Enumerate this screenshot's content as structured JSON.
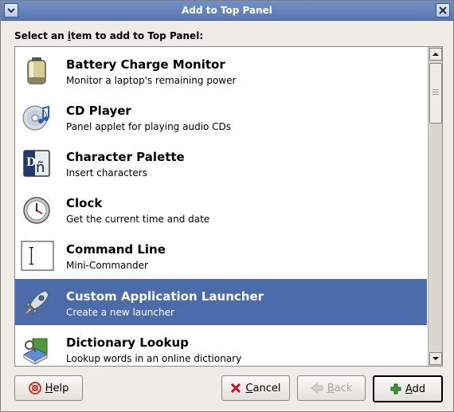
{
  "window": {
    "title": "Add to Top Panel"
  },
  "prompt": {
    "pre": "Select an ",
    "mnemonic": "i",
    "post": "tem to add to Top Panel:"
  },
  "items": [
    {
      "title": "Battery Charge Monitor",
      "description": "Monitor a laptop's remaining power",
      "icon": "battery-icon"
    },
    {
      "title": "CD Player",
      "description": "Panel applet for playing audio CDs",
      "icon": "cd-player-icon"
    },
    {
      "title": "Character Palette",
      "description": "Insert characters",
      "icon": "character-palette-icon"
    },
    {
      "title": "Clock",
      "description": "Get the current time and date",
      "icon": "clock-icon"
    },
    {
      "title": "Command Line",
      "description": "Mini-Commander",
      "icon": "command-line-icon"
    },
    {
      "title": "Custom Application Launcher",
      "description": "Create a new launcher",
      "icon": "rocket-icon",
      "selected": true
    },
    {
      "title": "Dictionary Lookup",
      "description": "Lookup words in an online dictionary",
      "icon": "dictionary-icon"
    }
  ],
  "palette_glyph": "ñ",
  "buttons": {
    "help": {
      "mnemonic": "H",
      "rest": "elp"
    },
    "cancel": {
      "mnemonic": "C",
      "rest": "ancel"
    },
    "back": {
      "mnemonic": "B",
      "rest": "ack"
    },
    "add": {
      "mnemonic": "A",
      "rest": "dd"
    }
  },
  "colors": {
    "titlebar": "#5f7fbb",
    "selection": "#4b6bab",
    "window_bg": "#efebe7"
  }
}
